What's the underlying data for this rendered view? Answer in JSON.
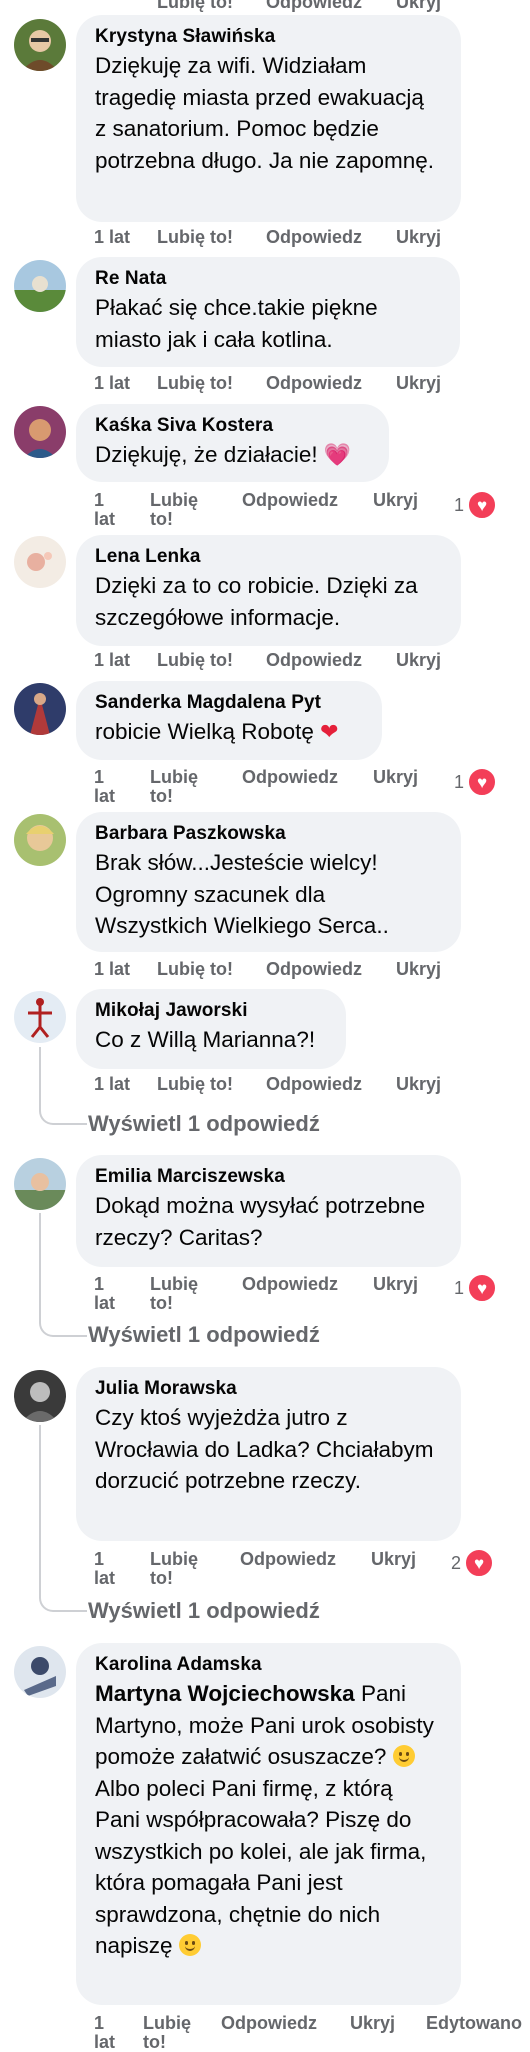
{
  "actions": {
    "time": "1 lat",
    "like": "Lubię to!",
    "reply": "Odpowiedz",
    "hide": "Ukryj",
    "edited": "Edytowano"
  },
  "comments": [
    {
      "author": "Krystyna Sławińska",
      "text": "Dziękuję za wifi. Widziałam tragedię miasta przed ewakuacją z sanatorium. Pomoc będzie potrzebna długo. Ja nie zapomnę.",
      "avatar_color": "#5b7a3a"
    },
    {
      "author": "Re Nata",
      "text": "Płakać się chce.takie piękne miasto jak i cała kotlina.",
      "avatar_color": "#7aa05a"
    },
    {
      "author": "Kaśka Siva Kostera",
      "text": "Dziękuję, że działacie!",
      "emoji": "💗",
      "reactions": "1",
      "avatar_color": "#8a3d6a"
    },
    {
      "author": "Lena Lenka",
      "text": "Dzięki za to co robicie. Dzięki za szczegółowe informacje.",
      "avatar_color": "#d8c8b0"
    },
    {
      "author": "Sanderka Magdalena Pyt",
      "text": "robicie Wielką Robotę",
      "emoji": "❤",
      "reactions": "1",
      "avatar_color": "#2f3c6a"
    },
    {
      "author": "Barbara Paszkowska",
      "text": "Brak słów...Jesteście wielcy! Ogromny szacunek dla Wszystkich Wielkiego Serca..",
      "avatar_color": "#c9a24a"
    },
    {
      "author": "Mikołaj Jaworski",
      "text": "Co z Willą Marianna?!",
      "view_replies": "Wyświetl 1 odpowiedź",
      "avatar_color": "#b9c6d8"
    },
    {
      "author": "Emilia Marciszewska",
      "text": "Dokąd można wysyłać potrzebne rzeczy? Caritas?",
      "reactions": "1",
      "view_replies": "Wyświetl 1 odpowiedź",
      "avatar_color": "#7ca0b8"
    },
    {
      "author": "Julia Morawska",
      "text": "Czy ktoś wyjeżdża jutro z Wrocławia do Ladka? Chciałabym dorzucić potrzebne rzeczy.",
      "reactions": "2",
      "view_replies": "Wyświetl 1 odpowiedź",
      "avatar_color": "#3a3a3a"
    },
    {
      "author": "Karolina Adamska",
      "mention": "Martyna Wojciechowska",
      "text": " Pani Martyno, może Pani urok osobisty pomoże załatwić osuszacze?",
      "text2": " Albo poleci Pani firmę, z którą Pani współpracowała? Piszę do wszystkich po kolei, ale jak firma, która pomagała Pani jest sprawdzona, chętnie do nich napiszę",
      "avatar_color": "#8aa0b8"
    }
  ],
  "top_cut": {
    "like": "Lubię to!",
    "reply": "Odpowiedz",
    "hide": "Ukryj"
  }
}
